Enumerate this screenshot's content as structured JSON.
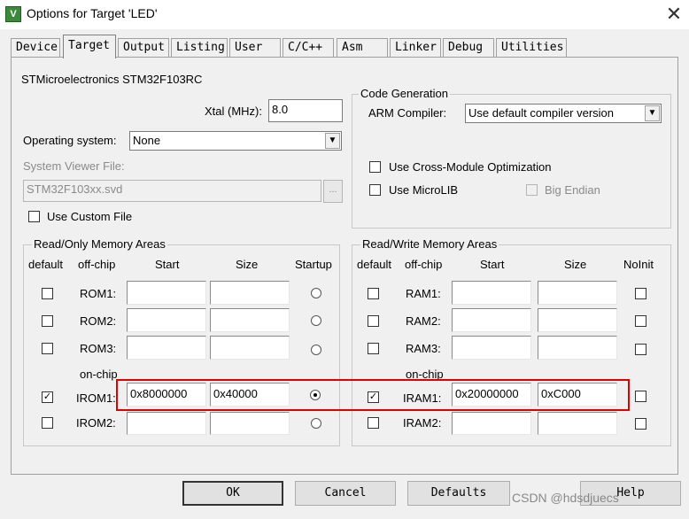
{
  "window": {
    "title": "Options for Target 'LED'",
    "icon_text": "V",
    "close_glyph": "✕"
  },
  "tabs": [
    {
      "label": "Device"
    },
    {
      "label": "Target"
    },
    {
      "label": "Output"
    },
    {
      "label": "Listing"
    },
    {
      "label": "User"
    },
    {
      "label": "C/C++"
    },
    {
      "label": "Asm"
    },
    {
      "label": "Linker"
    },
    {
      "label": "Debug"
    },
    {
      "label": "Utilities"
    }
  ],
  "target": {
    "device_name": "STMicroelectronics STM32F103RC",
    "xtal_label": "Xtal (MHz):",
    "xtal_value": "8.0",
    "os_label": "Operating system:",
    "os_value": "None",
    "svd_label": "System Viewer File:",
    "svd_value": "STM32F103xx.svd",
    "browse_label": "...",
    "custom_file_label": "Use Custom File"
  },
  "codegen": {
    "title": "Code Generation",
    "compiler_label": "ARM Compiler:",
    "compiler_value": "Use default compiler version",
    "cross_module_label": "Use Cross-Module Optimization",
    "microlib_label": "Use MicroLIB",
    "big_endian_label": "Big Endian"
  },
  "rom": {
    "title": "Read/Only Memory Areas",
    "headers": {
      "default": "default",
      "offchip": "off-chip",
      "start": "Start",
      "size": "Size",
      "startup": "Startup"
    },
    "onchip_label": "on-chip",
    "rows": [
      {
        "label": "ROM1:",
        "start": "",
        "size": ""
      },
      {
        "label": "ROM2:",
        "start": "",
        "size": ""
      },
      {
        "label": "ROM3:",
        "start": "",
        "size": ""
      },
      {
        "label": "IROM1:",
        "start": "0x8000000",
        "size": "0x40000"
      },
      {
        "label": "IROM2:",
        "start": "",
        "size": ""
      }
    ]
  },
  "ram": {
    "title": "Read/Write Memory Areas",
    "headers": {
      "default": "default",
      "offchip": "off-chip",
      "start": "Start",
      "size": "Size",
      "noinit": "NoInit"
    },
    "onchip_label": "on-chip",
    "rows": [
      {
        "label": "RAM1:",
        "start": "",
        "size": ""
      },
      {
        "label": "RAM2:",
        "start": "",
        "size": ""
      },
      {
        "label": "RAM3:",
        "start": "",
        "size": ""
      },
      {
        "label": "IRAM1:",
        "start": "0x20000000",
        "size": "0xC000"
      },
      {
        "label": "IRAM2:",
        "start": "",
        "size": ""
      }
    ]
  },
  "buttons": {
    "ok": "OK",
    "cancel": "Cancel",
    "defaults": "Defaults",
    "help": "Help"
  },
  "watermark": "CSDN @hdsdjuecs",
  "colors": {
    "highlight": "#e00000",
    "app_icon": "#3a8a3a"
  }
}
